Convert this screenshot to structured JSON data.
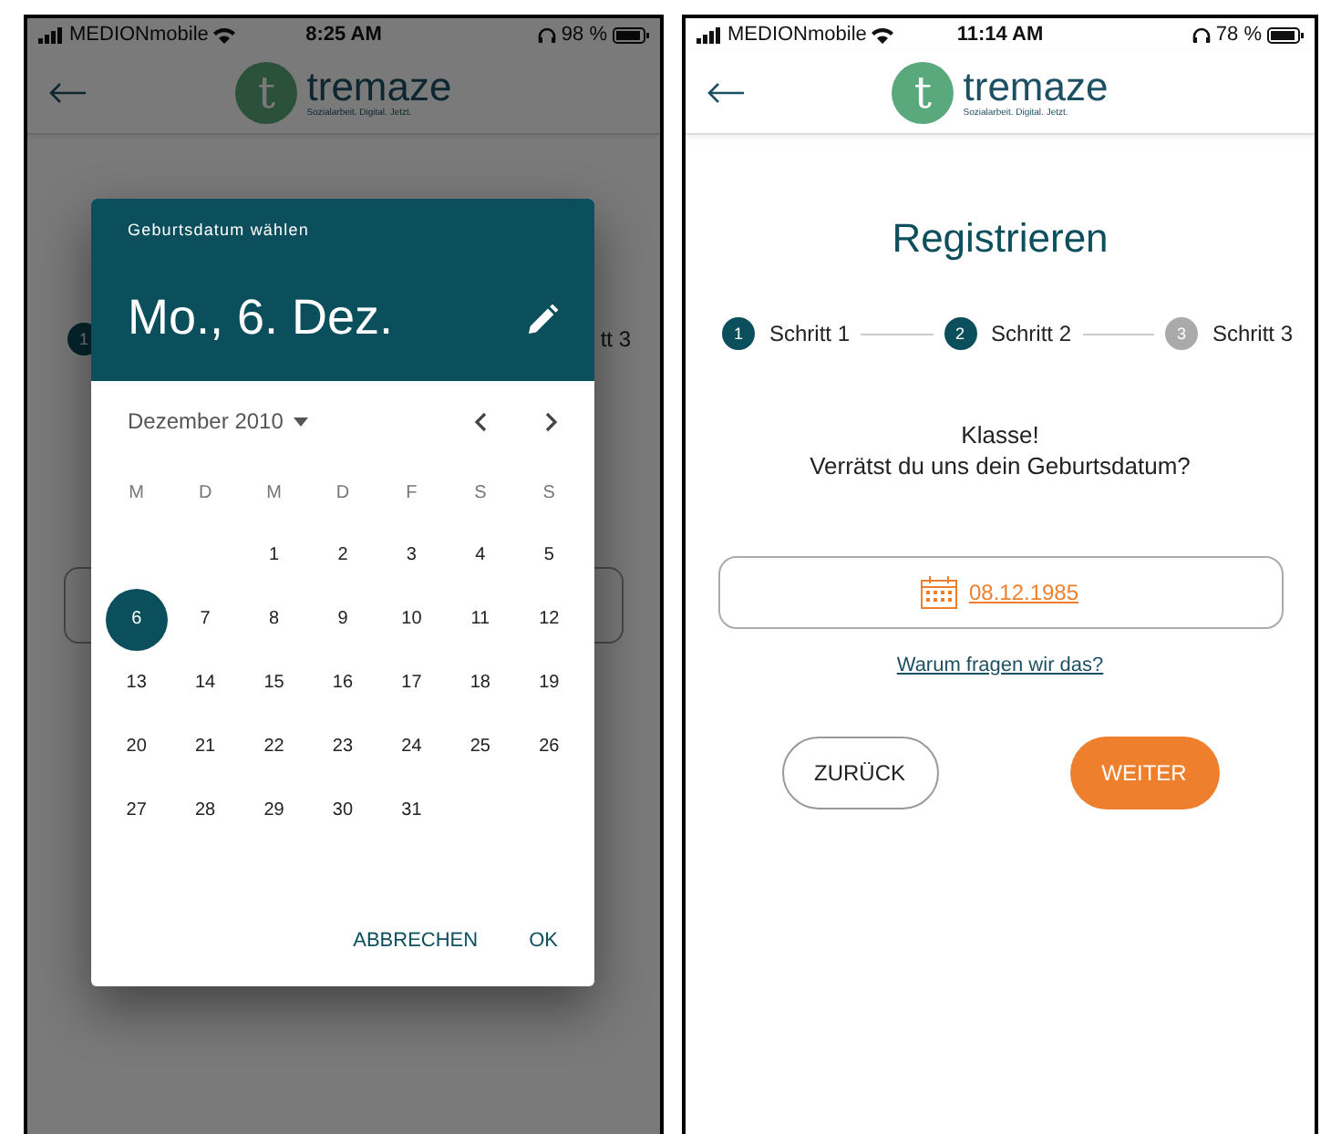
{
  "screens": [
    {
      "status_bar": {
        "carrier": "MEDIONmobile",
        "time": "8:25 AM",
        "battery": "98 %"
      },
      "header": {
        "logo_letter": "t",
        "logo_name": "tremaze",
        "tagline": "Sozialarbeit. Digital. Jetzt."
      },
      "behind": {
        "step_number": "1",
        "step_label": "tt 3"
      },
      "date_picker": {
        "title": "Geburtsdatum wählen",
        "selected_date": "Mo., 6. Dez.",
        "month": "Dezember 2010",
        "weekdays": [
          "M",
          "D",
          "M",
          "D",
          "F",
          "S",
          "S"
        ],
        "weeks": [
          {
            "days": [
              {
                "label": "1",
                "selected": false
              },
              {
                "label": "2",
                "selected": false
              },
              {
                "label": "3",
                "selected": false
              },
              {
                "label": "4",
                "selected": false
              },
              {
                "label": "5",
                "selected": false
              }
            ]
          },
          {
            "days": [
              {
                "label": "6",
                "selected": true
              },
              {
                "label": "7",
                "selected": false
              },
              {
                "label": "8",
                "selected": false
              },
              {
                "label": "9",
                "selected": false
              },
              {
                "label": "10",
                "selected": false
              },
              {
                "label": "11",
                "selected": false
              },
              {
                "label": "12",
                "selected": false
              }
            ]
          },
          {
            "days": [
              {
                "label": "13",
                "selected": false
              },
              {
                "label": "14",
                "selected": false
              },
              {
                "label": "15",
                "selected": false
              },
              {
                "label": "16",
                "selected": false
              },
              {
                "label": "17",
                "selected": false
              },
              {
                "label": "18",
                "selected": false
              },
              {
                "label": "19",
                "selected": false
              }
            ]
          },
          {
            "days": [
              {
                "label": "20",
                "selected": false
              },
              {
                "label": "21",
                "selected": false
              },
              {
                "label": "22",
                "selected": false
              },
              {
                "label": "23",
                "selected": false
              },
              {
                "label": "24",
                "selected": false
              },
              {
                "label": "25",
                "selected": false
              },
              {
                "label": "26",
                "selected": false
              }
            ]
          },
          {
            "days": [
              {
                "label": "27",
                "selected": false
              },
              {
                "label": "28",
                "selected": false
              },
              {
                "label": "29",
                "selected": false
              },
              {
                "label": "30",
                "selected": false
              },
              {
                "label": "31",
                "selected": false
              }
            ]
          }
        ],
        "actions": [
          "ABBRECHEN",
          "OK"
        ]
      }
    },
    {
      "status_bar": {
        "carrier": "MEDIONmobile",
        "time": "11:14 AM",
        "battery": "78 %"
      },
      "header": {
        "logo_letter": "t",
        "logo_name": "tremaze",
        "tagline": "Sozialarbeit. Digital. Jetzt."
      },
      "registration": {
        "title": "Registrieren",
        "steps": [
          {
            "number": "1",
            "label": "Schritt 1",
            "reached": true
          },
          {
            "number": "2",
            "label": "Schritt 2",
            "reached": true
          },
          {
            "number": "3",
            "label": "Schritt 3",
            "reached": false
          }
        ],
        "message": [
          "Klasse!",
          "Verrätst du uns dein Geburtsdatum?"
        ],
        "date_field": {
          "value": "08.12.1985"
        },
        "info_link": "Warum fragen wir das?",
        "buttons": [
          {
            "label": "ZURÜCK",
            "kind": "secondary"
          },
          {
            "label": "WEITER",
            "kind": "primary"
          }
        ]
      }
    }
  ]
}
